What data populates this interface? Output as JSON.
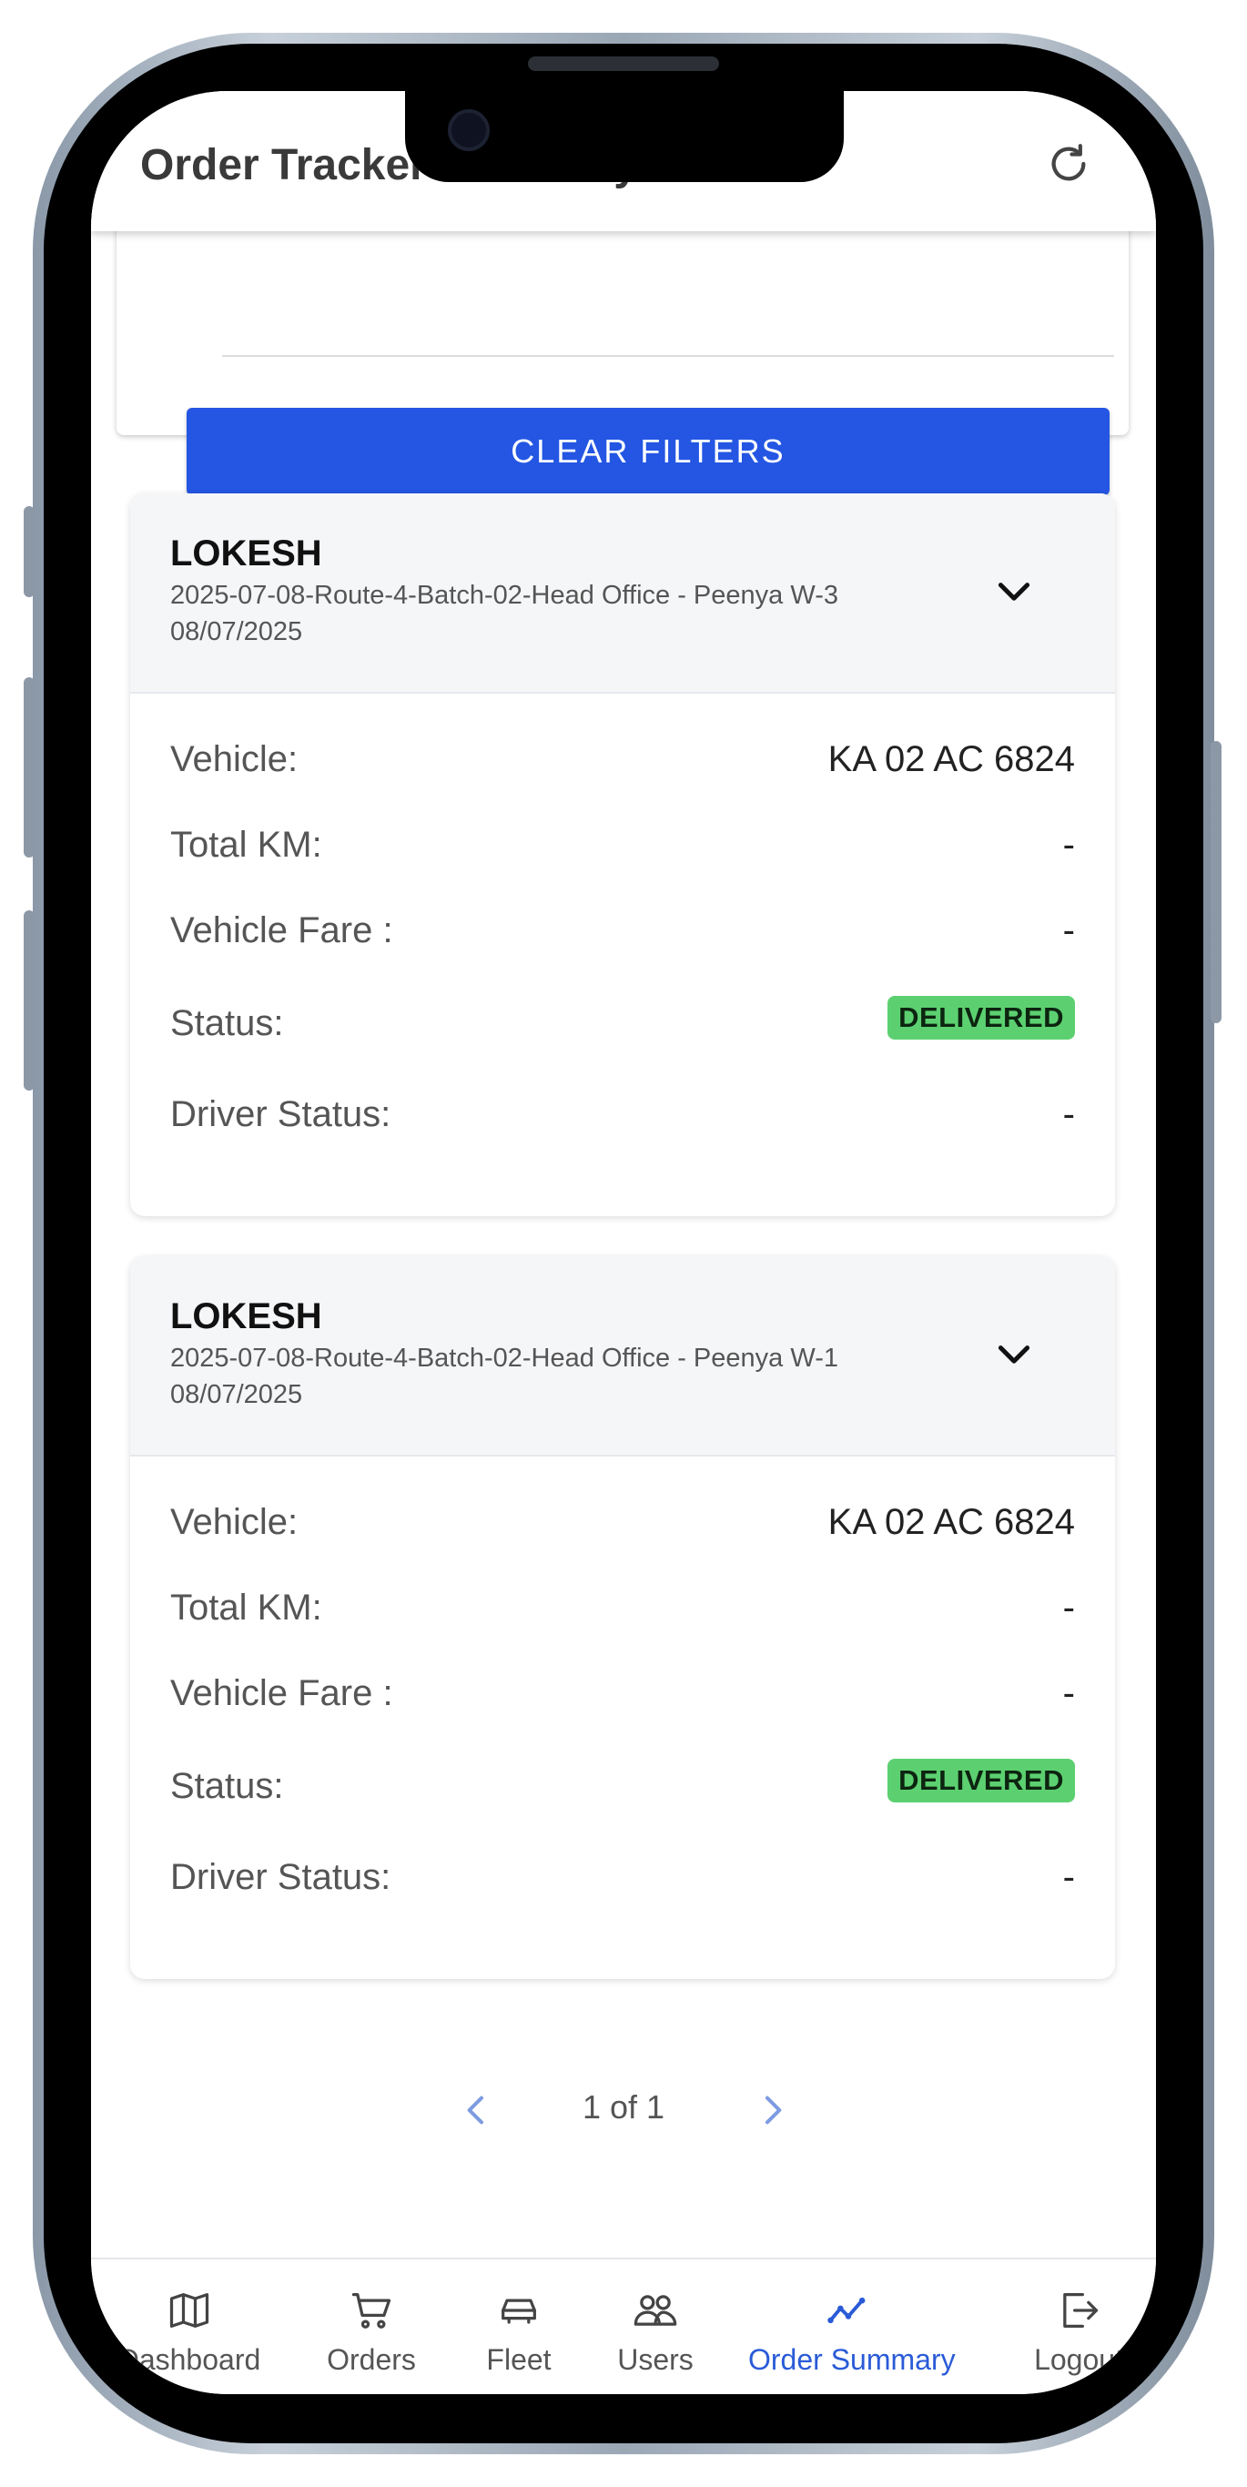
{
  "app": {
    "title": "Order Tracker Summary"
  },
  "filters": {
    "clear_label": "CLEAR FILTERS"
  },
  "orders": [
    {
      "driver": "LOKESH",
      "route": "2025-07-08-Route-4-Batch-02-Head Office - Peenya W-3",
      "date": "08/07/2025",
      "vehicle_label": "Vehicle:",
      "vehicle": "KA 02 AC 6824",
      "total_km_label": "Total KM:",
      "total_km": "-",
      "fare_label": "Vehicle Fare :",
      "fare": "-",
      "status_label": "Status:",
      "status": "DELIVERED",
      "driver_status_label": "Driver Status:",
      "driver_status": "-"
    },
    {
      "driver": "LOKESH",
      "route": "2025-07-08-Route-4-Batch-02-Head Office - Peenya W-1",
      "date": "08/07/2025",
      "vehicle_label": "Vehicle:",
      "vehicle": "KA 02 AC 6824",
      "total_km_label": "Total KM:",
      "total_km": "-",
      "fare_label": "Vehicle Fare :",
      "fare": "-",
      "status_label": "Status:",
      "status": "DELIVERED",
      "driver_status_label": "Driver Status:",
      "driver_status": "-"
    }
  ],
  "pagination": {
    "text": "1 of 1"
  },
  "nav": {
    "items": [
      {
        "label": "Dashboard",
        "icon": "map-icon"
      },
      {
        "label": "Orders",
        "icon": "cart-icon"
      },
      {
        "label": "Fleet",
        "icon": "car-icon"
      },
      {
        "label": "Users",
        "icon": "users-icon"
      },
      {
        "label": "Order Summary",
        "icon": "chart-line-icon",
        "active": true
      },
      {
        "label": "Logout",
        "icon": "logout-icon"
      }
    ]
  },
  "colors": {
    "primary": "#2456e3",
    "active_nav": "#2a5bd7",
    "delivered_badge": "#5cd070"
  }
}
